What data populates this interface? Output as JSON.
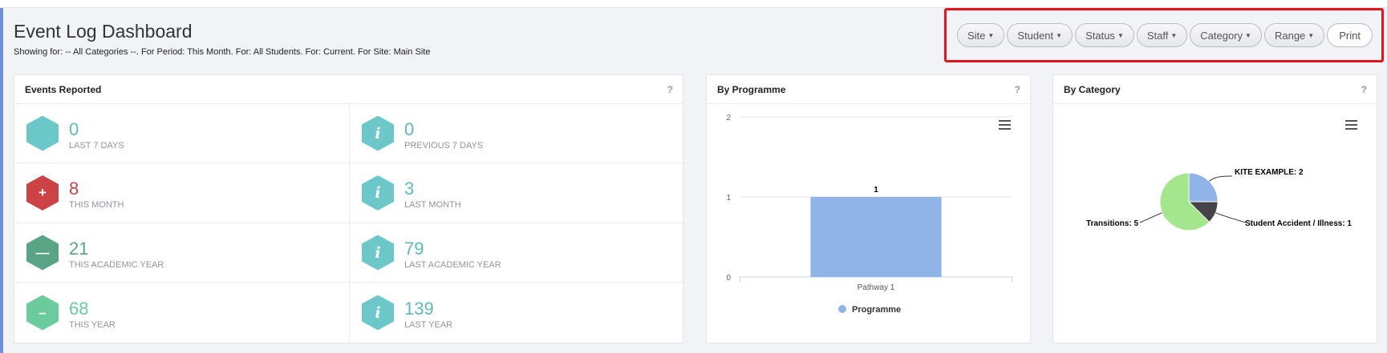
{
  "page": {
    "title": "Event Log Dashboard",
    "subtitle": "Showing for: -- All Categories --. For Period: This Month. For: All Students. For: Current. For Site: Main Site"
  },
  "filters": [
    {
      "label": "Site",
      "dropdown": true
    },
    {
      "label": "Student",
      "dropdown": true
    },
    {
      "label": "Status",
      "dropdown": true
    },
    {
      "label": "Staff",
      "dropdown": true
    },
    {
      "label": "Category",
      "dropdown": true
    },
    {
      "label": "Range",
      "dropdown": true
    },
    {
      "label": "Print",
      "dropdown": false
    }
  ],
  "icons": {
    "caret": "caret-down-icon",
    "help": "question-icon",
    "menu": "hamburger-menu-icon"
  },
  "colors": {
    "teal": "#6cc7c8",
    "red": "#cc4346",
    "dark_green": "#5aa486",
    "light_green": "#6ccb9c",
    "bar": "#90b4e8",
    "pie_blue": "#90b4e8",
    "pie_dark": "#434348",
    "pie_green": "#a3e68d",
    "highlight": "#e3131c"
  },
  "events_panel": {
    "title": "Events Reported",
    "help": "?",
    "stats": [
      {
        "value": "0",
        "label": "LAST 7 DAYS",
        "icon": "hexagon-icon",
        "glyph": "",
        "color": "#6cc7c8"
      },
      {
        "value": "0",
        "label": "PREVIOUS 7 DAYS",
        "icon": "info-icon",
        "glyph": "i",
        "color": "#6cc7c8"
      },
      {
        "value": "8",
        "label": "THIS MONTH",
        "icon": "plus-icon",
        "glyph": "+",
        "color": "#cc4346"
      },
      {
        "value": "3",
        "label": "LAST MONTH",
        "icon": "info-icon",
        "glyph": "i",
        "color": "#6cc7c8"
      },
      {
        "value": "21",
        "label": "THIS ACADEMIC YEAR",
        "icon": "minus-icon",
        "glyph": "—",
        "color": "#5aa486"
      },
      {
        "value": "79",
        "label": "LAST ACADEMIC YEAR",
        "icon": "info-icon",
        "glyph": "i",
        "color": "#6cc7c8"
      },
      {
        "value": "68",
        "label": "THIS YEAR",
        "icon": "minus-icon",
        "glyph": "–",
        "color": "#6ccb9c"
      },
      {
        "value": "139",
        "label": "LAST YEAR",
        "icon": "info-icon",
        "glyph": "i",
        "color": "#6cc7c8"
      }
    ]
  },
  "programme_panel": {
    "title": "By Programme",
    "help": "?"
  },
  "category_panel": {
    "title": "By Category",
    "help": "?"
  },
  "chart_data": [
    {
      "type": "bar",
      "categories": [
        "Pathway 1"
      ],
      "series": [
        {
          "name": "Programme",
          "values": [
            1
          ]
        }
      ],
      "data_labels": [
        "1"
      ],
      "ylim": [
        0,
        2
      ],
      "yticks": [
        "0",
        "1",
        "2"
      ],
      "grid": true,
      "legend": "bottom-center"
    },
    {
      "type": "pie",
      "slices": [
        {
          "name": "KITE EXAMPLE",
          "value": 2,
          "label": "KITE EXAMPLE: 2",
          "color": "#90b4e8"
        },
        {
          "name": "Student Accident / Illness",
          "value": 1,
          "label": "Student Accident / Illness: 1",
          "color": "#434348"
        },
        {
          "name": "Transitions",
          "value": 5,
          "label": "Transitions: 5",
          "color": "#a3e68d"
        }
      ]
    }
  ]
}
